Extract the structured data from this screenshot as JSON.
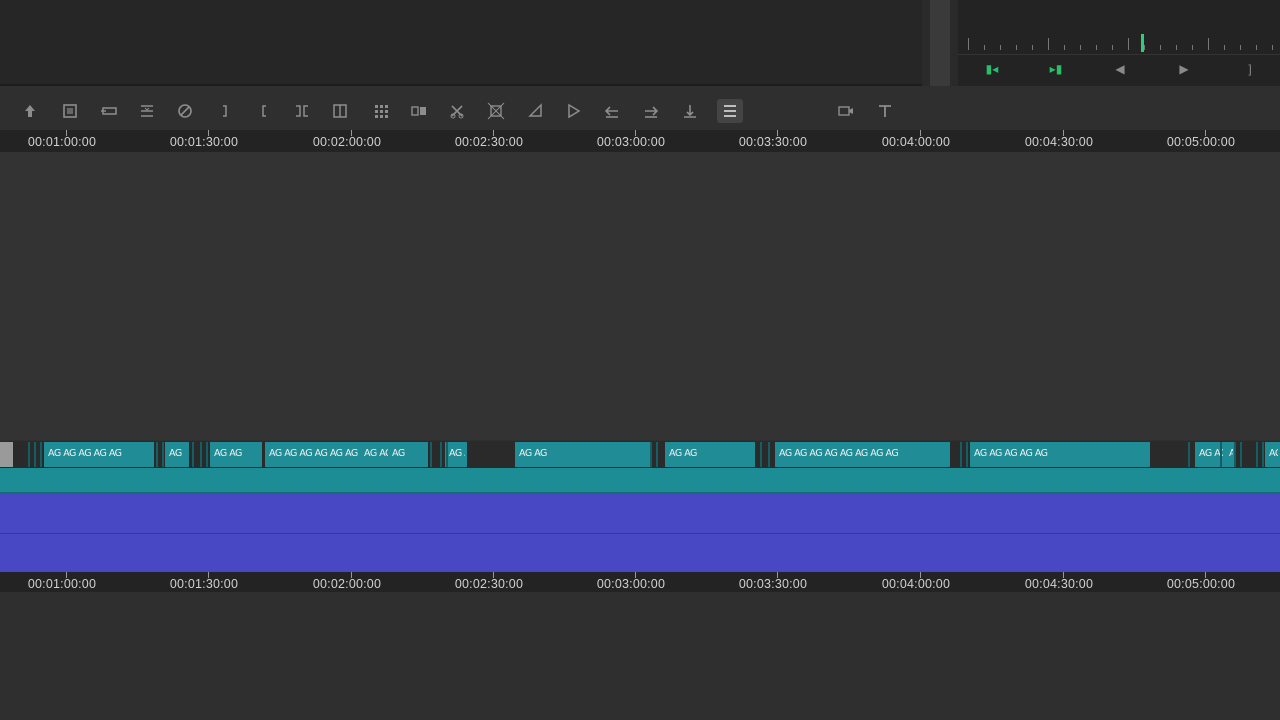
{
  "toolbar": {
    "icons": [
      "arrow-up-icon",
      "clip-icon",
      "insert-icon",
      "overwrite-icon",
      "disable-icon",
      "mark-out-icon",
      "mark-in-icon",
      "trim-icon",
      "split-frames-icon",
      "grid-icon",
      "match-frame-icon",
      "blade-icon",
      "transform-icon",
      "crop-icon",
      "perspective-icon",
      "align-left-icon",
      "align-right-icon",
      "align-bottom-icon",
      "list-icon",
      "video-link-icon",
      "text-tool-icon"
    ],
    "active": "list-icon"
  },
  "ruler": {
    "labels": [
      "00:01:00:00",
      "00:01:30:00",
      "00:02:00:00",
      "00:02:30:00",
      "00:03:00:00",
      "00:03:30:00",
      "00:04:00:00",
      "00:04:30:00",
      "00:05:00:00"
    ]
  },
  "clips": {
    "segments": [
      "AG AG AG AG AG",
      "AG",
      "AG AG",
      "AG AG AG AG AG AG",
      "AG AG",
      "AG",
      "AG AG AG AG AG AG AG",
      "AG AG",
      "AG AG",
      "AG AG AG AG AG AG AG AG",
      "AG AG AG AG AG",
      "AG AG AG AG",
      "AG",
      "AG"
    ]
  },
  "colors": {
    "video_track": "#1c8d94",
    "audio_track": "#4848c4",
    "playhead": "#26d07c"
  }
}
